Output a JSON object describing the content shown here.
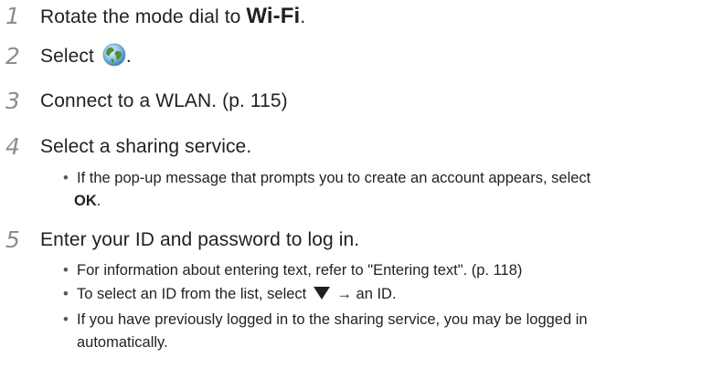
{
  "steps": [
    {
      "num": "1",
      "text": "Rotate the mode dial to ",
      "highlight": "Wi-Fi",
      "end": "."
    },
    {
      "num": "2",
      "text": "Select ",
      "icon": "globe-icon",
      "end": "."
    },
    {
      "num": "3",
      "text": "Connect to a WLAN. (p. 115)"
    },
    {
      "num": "4",
      "text": "Select a sharing service."
    },
    {
      "num": "5",
      "text": "Enter your ID and password to log in."
    }
  ],
  "step4_bullets": [
    {
      "pre": "If the pop-up message that prompts you to create an account appears, select",
      "bold": "OK",
      "post": "."
    }
  ],
  "step5_bullets": [
    {
      "text": "For information about entering text, refer to \"Entering text\". (p. 118)"
    },
    {
      "pre": "To select an ID from the list, select ",
      "icon": "down-triangle-icon",
      "post": " → an ID."
    },
    {
      "line1": "If you have previously logged in to the sharing service, you may be logged in",
      "line2": "automatically."
    }
  ],
  "colors": {
    "step_number": "#8c8c8c",
    "text": "#231f20"
  }
}
